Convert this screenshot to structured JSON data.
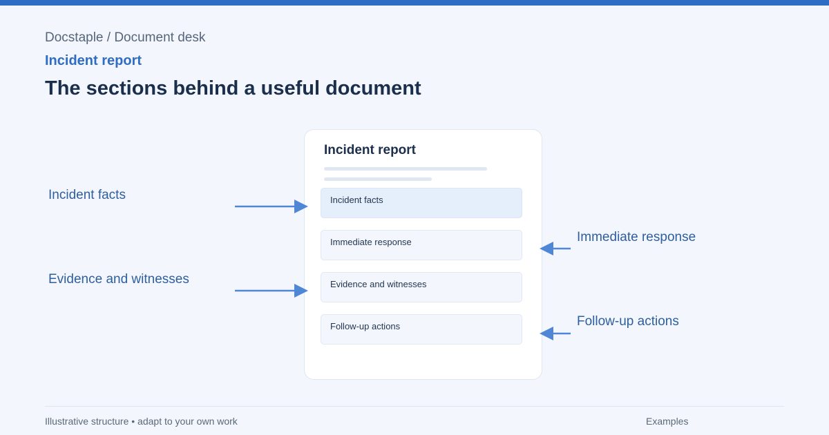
{
  "breadcrumb": "Docstaple / Document desk",
  "kicker": "Incident report",
  "title": "The sections behind a useful document",
  "document": {
    "title": "Incident report",
    "sections": [
      "Incident facts",
      "Immediate response",
      "Evidence and witnesses",
      "Follow-up actions"
    ]
  },
  "callouts": {
    "left": [
      "Incident facts",
      "Evidence and witnesses"
    ],
    "right": [
      "Immediate response",
      "Follow-up actions"
    ]
  },
  "colors": {
    "accent": "#2f6cc4",
    "arrow": "#4f86d6"
  },
  "footer": {
    "note": "Illustrative structure • adapt to your own work",
    "link": "Examples"
  }
}
